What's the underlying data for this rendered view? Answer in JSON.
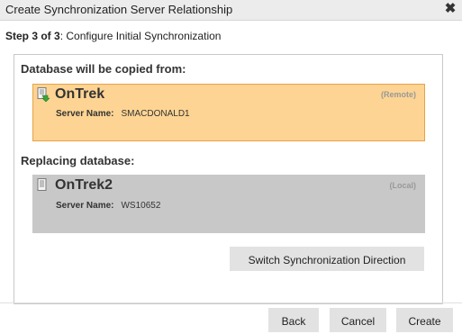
{
  "dialog": {
    "title": "Create Synchronization Server Relationship",
    "close_icon": "close-icon"
  },
  "step": {
    "prefix": "Step 3 of 3",
    "text": ": Configure Initial Synchronization"
  },
  "source": {
    "label": "Database will be copied from:",
    "database": "OnTrek",
    "tag": "(Remote)",
    "server_label": "Server Name:",
    "server_name": "SMACDONALD1",
    "icon": "database-sync-icon",
    "color": "#fdd493"
  },
  "target": {
    "label": "Replacing database:",
    "database": "OnTrek2",
    "tag": "(Local)",
    "server_label": "Server Name:",
    "server_name": "WS10652",
    "icon": "database-icon",
    "color": "#c8c8c8"
  },
  "buttons": {
    "switch": "Switch Synchronization Direction",
    "back": "Back",
    "cancel": "Cancel",
    "create": "Create"
  }
}
